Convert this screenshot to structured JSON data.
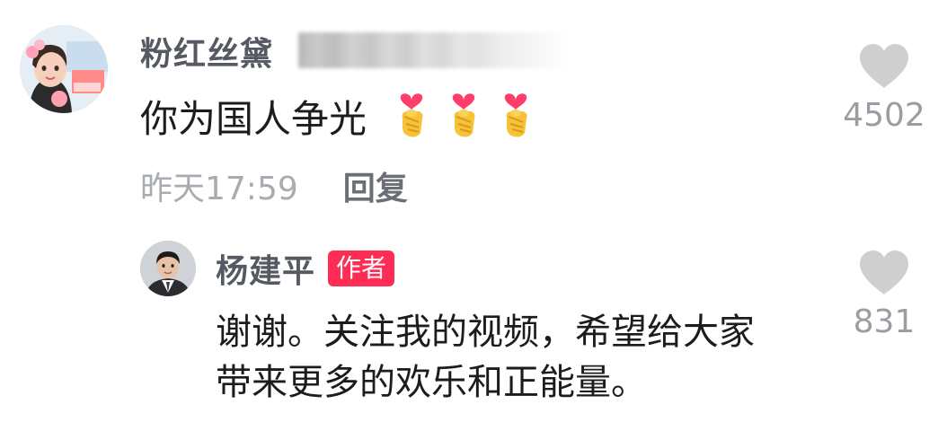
{
  "main_comment": {
    "username": "粉红丝黛",
    "text": "你为国人争光",
    "emoji": "finger-heart-emoji",
    "emoji_count": 3,
    "timestamp": "昨天17:59",
    "reply_label": "回复",
    "likes": "4502"
  },
  "reply": {
    "username": "杨建平",
    "badge": "作者",
    "text_line1": "谢谢。关注我的视频，希望给大家",
    "text_line2": "带来更多的欢乐和正能量。",
    "likes": "831"
  },
  "colors": {
    "badge_bg": "#ff2d55",
    "heart": "#cfcfcf",
    "username": "#555a62",
    "timestamp": "#a8abb0"
  }
}
